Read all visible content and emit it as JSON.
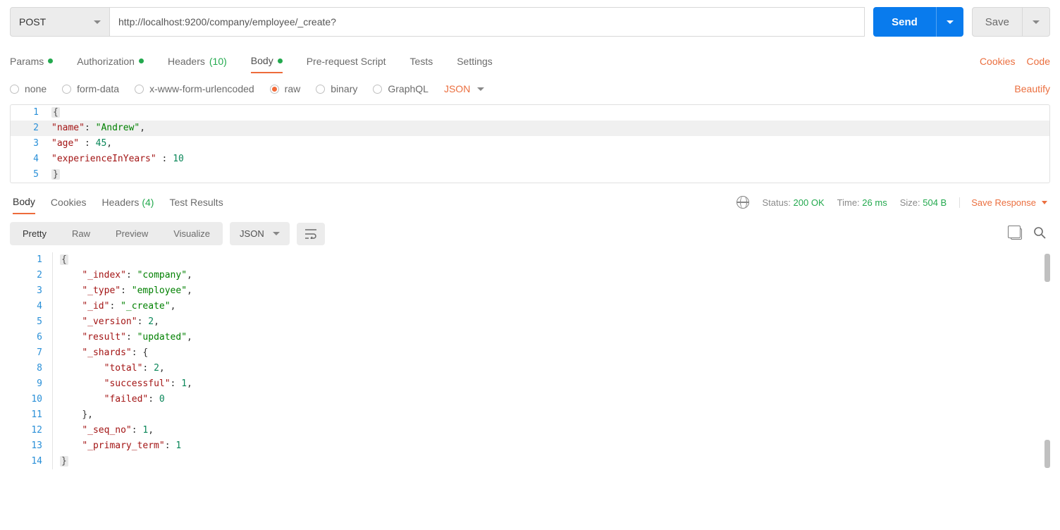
{
  "request": {
    "method": "POST",
    "url": "http://localhost:9200/company/employee/_create?",
    "send": "Send",
    "save": "Save"
  },
  "tabs": {
    "params": "Params",
    "authorization": "Authorization",
    "headers": "Headers",
    "headers_count": "(10)",
    "body": "Body",
    "prerequest": "Pre-request Script",
    "tests": "Tests",
    "settings": "Settings",
    "cookies": "Cookies",
    "code": "Code"
  },
  "bodyTypes": {
    "none": "none",
    "formdata": "form-data",
    "urlencoded": "x-www-form-urlencoded",
    "raw": "raw",
    "binary": "binary",
    "graphql": "GraphQL",
    "json": "JSON",
    "beautify": "Beautify"
  },
  "requestBody": {
    "l1": "{",
    "l2_key": "\"name\"",
    "l2_val": "\"Andrew\"",
    "l3_key": "\"age\"",
    "l3_val": "45",
    "l4_key": "\"experienceInYears\"",
    "l4_val": "10",
    "l5": "}"
  },
  "responseTabs": {
    "body": "Body",
    "cookies": "Cookies",
    "headers": "Headers",
    "headers_count": "(4)",
    "test_results": "Test Results"
  },
  "status": {
    "status_label": "Status:",
    "status_val": "200 OK",
    "time_label": "Time:",
    "time_val": "26 ms",
    "size_label": "Size:",
    "size_val": "504 B",
    "save_response": "Save Response"
  },
  "pretty": {
    "pretty": "Pretty",
    "raw": "Raw",
    "preview": "Preview",
    "visualize": "Visualize",
    "json": "JSON"
  },
  "responseBody": {
    "index_k": "\"_index\"",
    "index_v": "\"company\"",
    "type_k": "\"_type\"",
    "type_v": "\"employee\"",
    "id_k": "\"_id\"",
    "id_v": "\"_create\"",
    "version_k": "\"_version\"",
    "version_v": "2",
    "result_k": "\"result\"",
    "result_v": "\"updated\"",
    "shards_k": "\"_shards\"",
    "total_k": "\"total\"",
    "total_v": "2",
    "successful_k": "\"successful\"",
    "successful_v": "1",
    "failed_k": "\"failed\"",
    "failed_v": "0",
    "seqno_k": "\"_seq_no\"",
    "seqno_v": "1",
    "primary_k": "\"_primary_term\"",
    "primary_v": "1"
  }
}
